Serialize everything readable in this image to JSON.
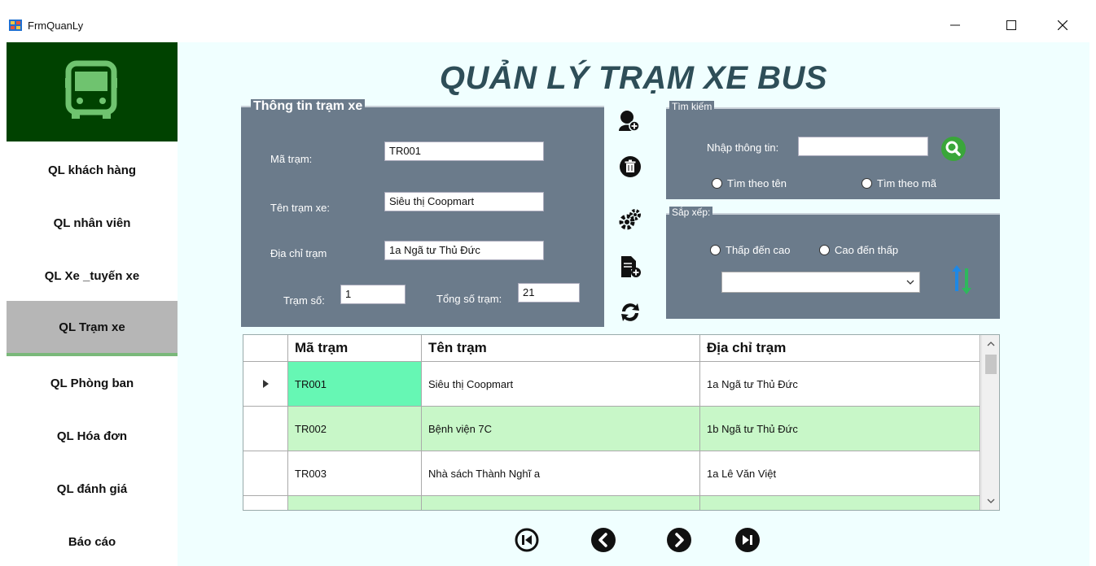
{
  "window": {
    "title": "FrmQuanLy",
    "icons": [
      "app-icon",
      "minimize-icon",
      "maximize-icon",
      "close-icon"
    ]
  },
  "colors": {
    "sidebar_logo_bg": "#004200",
    "panel_bg": "#6b7b8b",
    "main_bg": "#f0ffff",
    "title_color": "#2e4e58",
    "row_alt": "#c8f7c8",
    "row_selected": "#66f7b4"
  },
  "sidebar": {
    "logo_icon": "bus-icon",
    "items": [
      {
        "label": "QL khách hàng"
      },
      {
        "label": "QL nhân viên"
      },
      {
        "label": "QL Xe _tuyến xe"
      },
      {
        "label": "QL Trạm xe",
        "active": true
      },
      {
        "label": "QL Phòng ban"
      },
      {
        "label": "QL Hóa đơn"
      },
      {
        "label": "QL đánh giá"
      },
      {
        "label": "Báo cáo"
      }
    ]
  },
  "main": {
    "title": "QUẢN LÝ TRẠM XE BUS",
    "info_panel": {
      "legend": "Thông tin trạm xe",
      "ma_tram_label": "Mã trạm:",
      "ma_tram_value": "TR001",
      "ten_tram_label": "Tên trạm xe:",
      "ten_tram_value": "Siêu thị Coopmart",
      "dia_chi_label": "Địa chỉ trạm",
      "dia_chi_value": "1a Ngã tư Thủ Đức",
      "tram_so_label": "Trạm số:",
      "tram_so_value": "1",
      "tong_so_label": "Tổng số trạm:",
      "tong_so_value": "21"
    },
    "action_icons": [
      "add-user-icon",
      "delete-icon",
      "settings-icon",
      "add-file-icon",
      "refresh-icon"
    ],
    "search_panel": {
      "legend": "Tìm kiếm",
      "input_label": "Nhập thông tin:",
      "input_value": "",
      "radio_name": "Tìm theo tên",
      "radio_code": "Tìm theo mã"
    },
    "sort_panel": {
      "legend": "Sắp xếp:",
      "radio_asc": "Thấp đến cao",
      "radio_desc": "Cao đến thấp",
      "combo_value": ""
    },
    "grid": {
      "columns": [
        "Mã trạm",
        "Tên trạm",
        "Địa chỉ trạm"
      ],
      "rows": [
        [
          "TR001",
          "Siêu thị Coopmart",
          "1a Ngã tư Thủ Đức"
        ],
        [
          "TR002",
          "Bệnh viện 7C",
          "1b Ngã tư Thủ Đức"
        ],
        [
          "TR003",
          "Nhà sách Thành Nghĩ a",
          "1a Lê Văn Việt"
        ],
        [
          "",
          "",
          ""
        ]
      ]
    },
    "nav_icons": [
      "first-icon",
      "previous-icon",
      "next-icon",
      "last-icon"
    ]
  }
}
